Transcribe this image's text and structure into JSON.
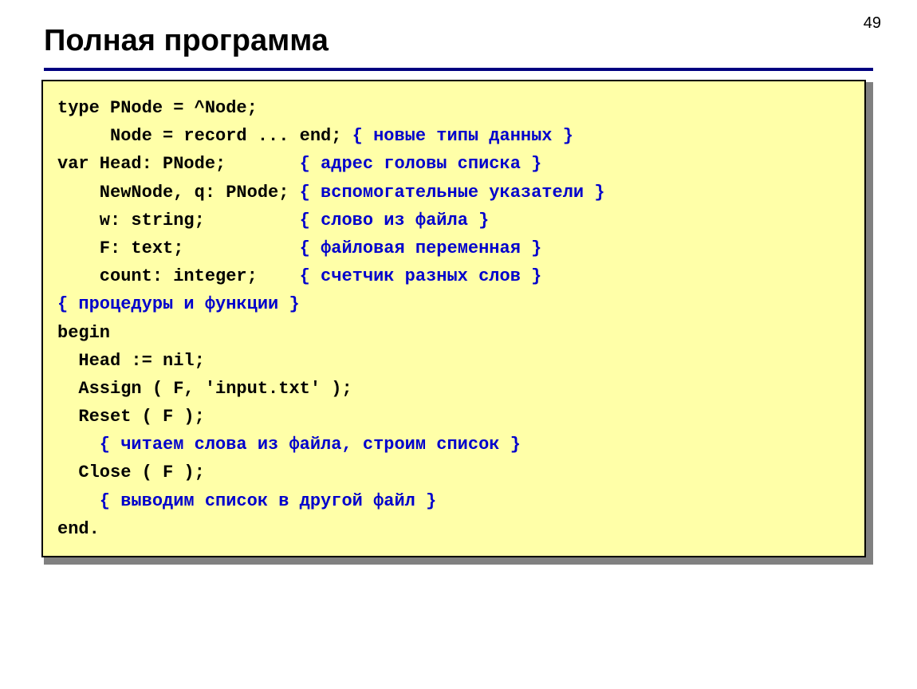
{
  "page_number": "49",
  "title": "Полная программа",
  "code": {
    "l1_a": "type PNode = ^Node;",
    "l2_a": "     Node = record ... end;",
    "l2_c": " { новые типы данных }",
    "l3_a": "var Head: PNode;",
    "l3_c": "       { адрес головы списка }",
    "l4_a": "    NewNode, q: PNode;",
    "l4_c": " { вспомогательные указатели }",
    "l5_a": "    w: string;",
    "l5_c": "         { слово из файла }",
    "l6_a": "    F: text;",
    "l6_c": "           { файловая переменная }",
    "l7_a": "    count: integer;",
    "l7_c": "    { счетчик разных слов }",
    "l8_c": "{ процедуры и функции }",
    "l9_a": "begin",
    "l10_a": "  Head := nil;",
    "l11_a": "  Assign ( F, 'input.txt' );",
    "l12_a": "  Reset ( F );",
    "l13_c": "    { читаем слова из файла, строим список }",
    "l14_a": "  Close ( F );",
    "l15_c": "    { выводим список в другой файл }",
    "l16_a": "end."
  }
}
